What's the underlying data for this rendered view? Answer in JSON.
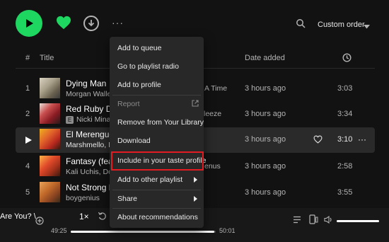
{
  "toolbar": {
    "play_icon": "play-icon",
    "heart_icon": "heart-filled-icon",
    "download_icon": "download-icon",
    "more_label": "···",
    "sort_label": "Custom order"
  },
  "colors": {
    "accent": "#1ed760",
    "highlight_box": "#e31b23",
    "background": "#121212",
    "menu_bg": "#282828"
  },
  "table": {
    "headers": {
      "number": "#",
      "title": "Title",
      "date_added": "Date added",
      "duration_icon": "clock-icon"
    },
    "rows": [
      {
        "num": "1",
        "title": "Dying Man",
        "artist": "Morgan Waller",
        "explicit": false,
        "album": "A Time",
        "added": "3 hours ago",
        "duration": "3:03"
      },
      {
        "num": "2",
        "title": "Red Ruby Da",
        "artist": "Nicki Minaj",
        "explicit": true,
        "explicit_label": "E",
        "album": "leeze",
        "added": "3 hours ago",
        "duration": "3:34"
      },
      {
        "num": "",
        "title": "El Merengue",
        "artist": "Marshmello, M",
        "explicit": false,
        "album": "",
        "added": "3 hours ago",
        "duration": "3:10"
      },
      {
        "num": "4",
        "title": "Fantasy (feat.",
        "artist": "Kali Uchis, Don",
        "explicit": false,
        "album": "enus",
        "added": "3 hours ago",
        "duration": "2:58"
      },
      {
        "num": "5",
        "title": "Not Strong E",
        "artist": "boygenius",
        "explicit": false,
        "album": "",
        "added": "3 hours ago",
        "duration": "3:55"
      }
    ]
  },
  "context_menu": {
    "items": [
      {
        "label": "Add to queue"
      },
      {
        "label": "Go to playlist radio"
      },
      {
        "label": "Add to profile"
      },
      {
        "label": "Report"
      },
      {
        "label": "Remove from Your Library"
      },
      {
        "label": "Download"
      },
      {
        "label": "Include in your taste profile"
      },
      {
        "label": "Add to other playlist"
      },
      {
        "label": "Share"
      },
      {
        "label": "About recommendations"
      }
    ]
  },
  "player": {
    "now_playing": "Are You? \\",
    "speed": "1×",
    "position": "49:25",
    "duration": "50:01",
    "progress_fraction": 0.988,
    "volume_fraction": 1.0
  }
}
